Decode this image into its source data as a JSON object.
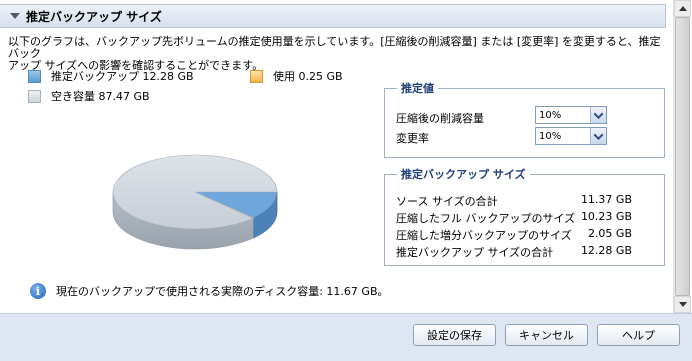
{
  "section": {
    "title": "推定バックアップ サイズ"
  },
  "description": {
    "line1": "以下のグラフは、バックアップ先ボリュームの推定使用量を示しています。[圧縮後の削減容量] または [変更率] を変更すると、推定バック",
    "line2": "アップ サイズへの影響を確認することができます。"
  },
  "legend": {
    "estimated": "推定バックアップ 12.28 GB",
    "used": "使用 0.25 GB",
    "free": "空き容量 87.47 GB"
  },
  "colors": {
    "estimated": "#6fa6dc",
    "used": "#f4b64a",
    "free": "#cfd6de",
    "accent": "#1d3f7a"
  },
  "chart_data": {
    "type": "pie",
    "slices": [
      {
        "label": "推定バックアップ",
        "value": 12.28
      },
      {
        "label": "使用",
        "value": 0.25
      },
      {
        "label": "空き容量",
        "value": 87.47
      }
    ]
  },
  "info": {
    "text": "現在のバックアップで使用される実際のディスク容量: 11.67 GB。"
  },
  "estimates": {
    "title": "推定値",
    "compression_label": "圧縮後の削減容量",
    "compression_value": "10%",
    "change_rate_label": "変更率",
    "change_rate_value": "10%"
  },
  "sizes": {
    "title": "推定バックアップ サイズ",
    "rows": [
      {
        "label": "ソース サイズの合計",
        "value": "11.37 GB"
      },
      {
        "label": "圧縮したフル バックアップのサイズ",
        "value": "10.23 GB"
      },
      {
        "label": "圧縮した増分バックアップのサイズ",
        "value": "2.05 GB"
      },
      {
        "label": "推定バックアップ サイズの合計",
        "value": "12.28 GB"
      }
    ]
  },
  "buttons": {
    "save": "設定の保存",
    "cancel": "キャンセル",
    "help": "ヘルプ"
  }
}
